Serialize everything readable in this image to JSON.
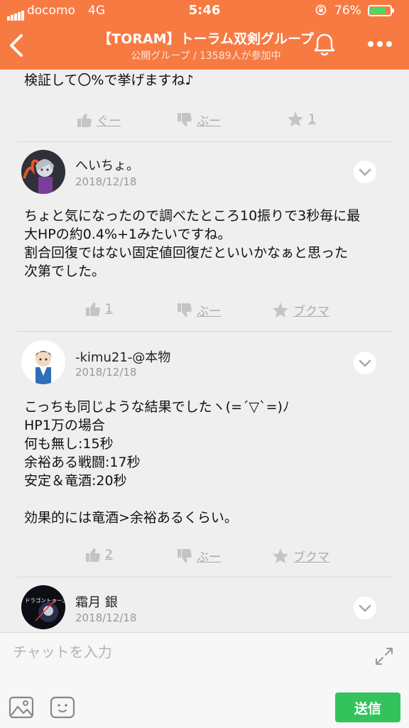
{
  "status_bar": {
    "carrier": "docomo",
    "network": "4G",
    "time": "5:46",
    "battery_percent": "76%",
    "battery_level": 0.76
  },
  "header": {
    "title": "【TORAM】トーラム双剣グループ",
    "subtitle": "公開グループ / 13589人が参加中",
    "icons": [
      "back-chevron-icon",
      "bell-icon",
      "more-dots-icon"
    ]
  },
  "posts": [
    {
      "body": "検証して〇%で挙げますね♪",
      "actions": {
        "like": "ぐー",
        "dislike": "ぶー",
        "bookmark": "1"
      }
    },
    {
      "username": "へいちょ。",
      "date": "2018/12/18",
      "body": "ちょと気になったので調べたところ10振りで3秒毎に最\n大HPの約0.4%+1みたいですね。\n割合回復ではない固定値回復だといいかなぁと思った\n次第でした。",
      "actions": {
        "like": "1",
        "dislike": "ぶー",
        "bookmark": "ブクマ"
      }
    },
    {
      "username": "-kimu21-@本物",
      "date": "2018/12/18",
      "body": "こっちも同じような結果でしたヽ(=´▽`=)ﾉ\nHP1万の場合\n何も無し:15秒\n余裕ある戦闘:17秒\n安定＆竜酒:20秒\n\n効果的には竜酒>余裕あるくらい。",
      "actions": {
        "like": "2",
        "dislike": "ぶー",
        "bookmark": "ブクマ"
      }
    },
    {
      "username": "霜月 銀",
      "date": "2018/12/18",
      "avatar_text": "ドラゴントゥース"
    }
  ],
  "input_bar": {
    "placeholder": "チャットを入力",
    "send_label": "送信"
  },
  "colors": {
    "header": "#f77a43",
    "send": "#33c25c",
    "background": "#efeff0"
  }
}
